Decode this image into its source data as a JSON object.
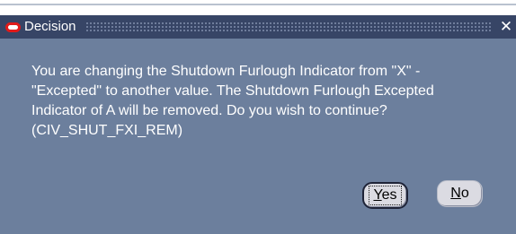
{
  "dialog": {
    "title": "Decision",
    "close_glyph": "✕",
    "message": "You are changing the Shutdown Furlough Indicator from \"X\" -\n\"Excepted\" to another value.  The Shutdown Furlough Excepted\nIndicator of A will be removed.  Do you wish to continue?\n(CIV_SHUT_FXI_REM)",
    "buttons": {
      "yes_mnemonic": "Y",
      "yes_rest": "es",
      "no_mnemonic": "N",
      "no_rest": "o"
    }
  },
  "colors": {
    "titlebar": "#374566",
    "body": "#6c7f9d",
    "button_face": "#dbdbe2",
    "app_icon": "#e11a1a"
  },
  "icons": {
    "app": "oracle-o-icon",
    "close": "close-icon"
  }
}
